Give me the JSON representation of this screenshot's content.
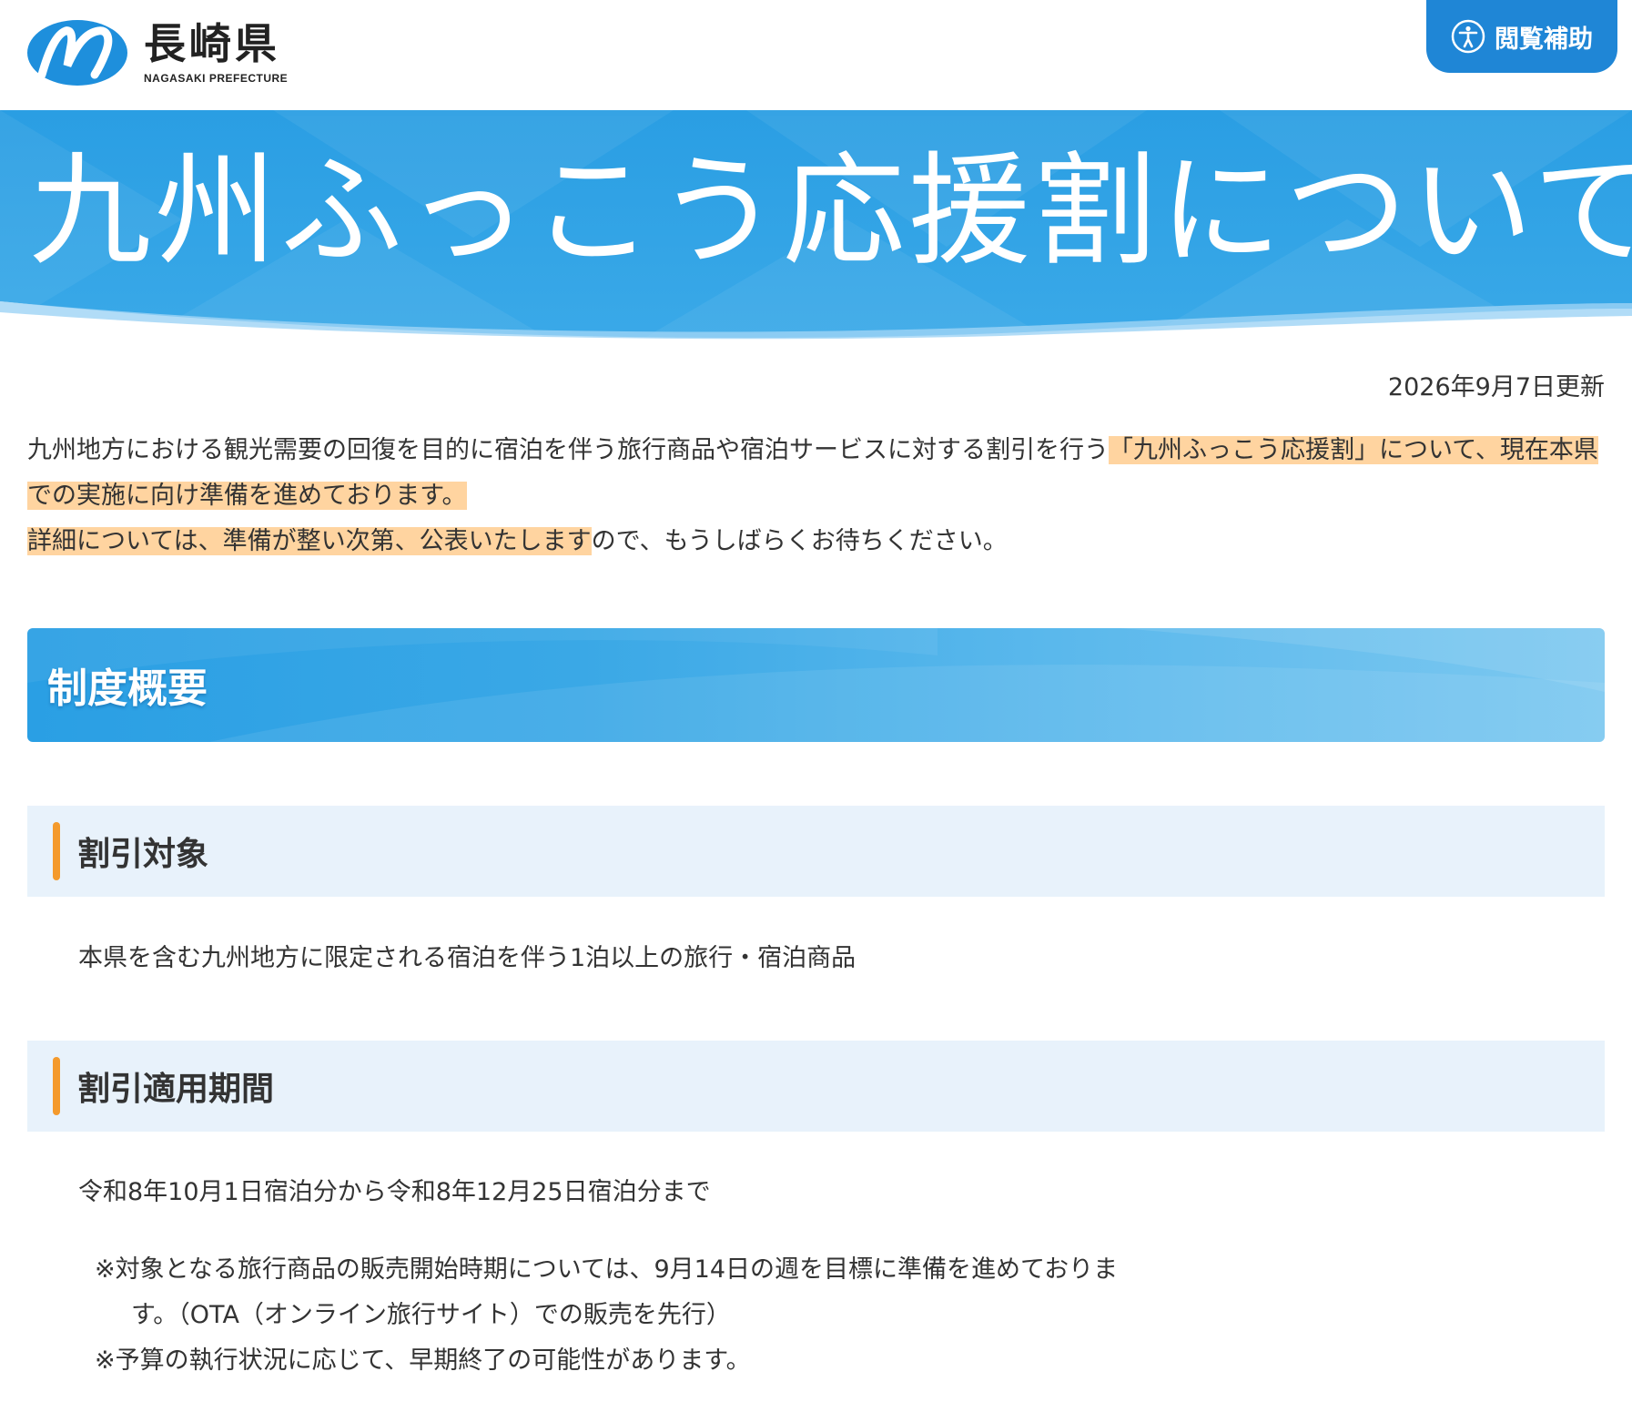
{
  "header": {
    "logo_jp": "長崎県",
    "logo_en": "NAGASAKI PREFECTURE",
    "accessibility_label": "閲覧補助",
    "logo_icon": "nagasaki-n-logo",
    "accessibility_icon": "accessibility-person-icon"
  },
  "hero": {
    "title": "九州ふっこう応援割について"
  },
  "updated": "2026年9月7日更新",
  "intro": {
    "line1_plain": "九州地方における観光需要の回復を目的に宿泊を伴う旅行商品や宿泊サービスに対する割引を行う",
    "line1_highlight": "「九州ふっこう応援割」について、現在本県での実施に向け準備を進めております。",
    "line2_highlight": "詳細については、準備が整い次第、公表いたします",
    "line2_plain": "ので、もうしばらくお待ちください。"
  },
  "section": {
    "title": "制度概要"
  },
  "discount_target": {
    "heading": "割引対象",
    "text": "本県を含む九州地方に限定される宿泊を伴う1泊以上の旅行・宿泊商品"
  },
  "discount_period": {
    "heading": "割引適用期間",
    "text": "令和8年10月1日宿泊分から令和8年12月25日宿泊分まで",
    "note1_line1": "※対象となる旅行商品の販売開始時期については、9月14日の週を目標に準備を進めておりま",
    "note1_line2": "す。（OTA（オンライン旅行サイト）での販売を先行）",
    "note2": "※予算の執行状況に応じて、早期終了の可能性があります。"
  },
  "colors": {
    "accent_blue": "#1f86d6",
    "hero_blue": "#2d9fe3",
    "highlight": "#ffd4a0",
    "subhead_bg": "#e8f2fb",
    "subhead_bar": "#f49a2c"
  }
}
